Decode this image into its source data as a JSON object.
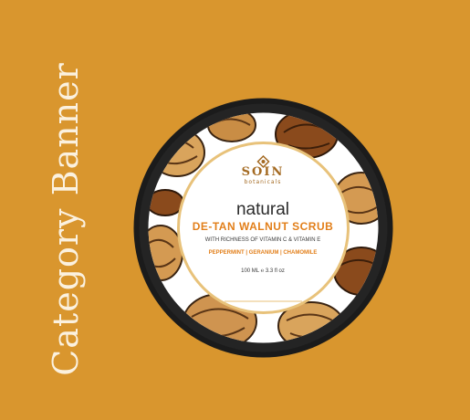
{
  "banner": {
    "side_text": "Category Banner",
    "background_color": "#d9962e"
  },
  "product_label": {
    "brand": "SOIN",
    "brand_sub": "botanicals",
    "natural": "natural",
    "product_name": "DE-TAN WALNUT SCRUB",
    "richness": "WITH RICHNESS OF VITAMIN C & VITAMIN E",
    "ingredients": "PEPPERMINT | GERANIUM | CHAMOMILE",
    "volume": "100 ML ℮ 3.3 fl oz",
    "accent_color": "#e27f1a"
  }
}
